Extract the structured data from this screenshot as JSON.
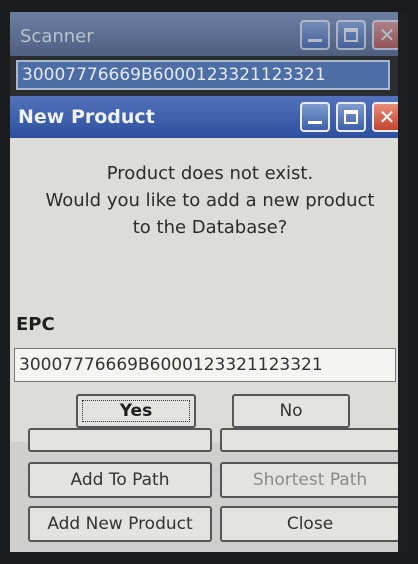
{
  "scanner": {
    "title": "Scanner",
    "scanned_epc": "30007776669B6000123321123321"
  },
  "dialog": {
    "title": "New Product",
    "message_lines": [
      "Product does not exist.",
      "Would you like to add a new product",
      "to the Database?"
    ],
    "epc_label": "EPC",
    "epc_value": "30007776669B6000123321123321",
    "yes_label": "Yes",
    "no_label": "No",
    "close_glyph": "✕"
  },
  "buttons": {
    "add_to_path": "Add To Path",
    "shortest_path": "Shortest Path",
    "add_new_product": "Add New Product",
    "close": "Close"
  },
  "icons": {
    "bg_close": "✕"
  }
}
